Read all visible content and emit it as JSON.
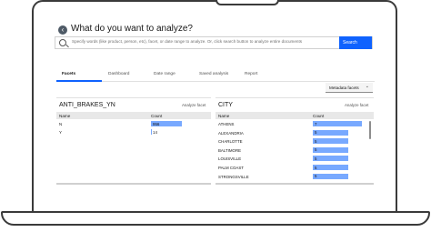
{
  "header": {
    "title": "What do you want to analyze?",
    "search_placeholder": "Specify words (like product, person, etc), facet, or date range to analyze. Or, click search button to analyze entire documents",
    "search_button": "Search"
  },
  "tabs": [
    "Facets",
    "Dashboard",
    "Date range",
    "Saved analysis",
    "Report"
  ],
  "metadata_dropdown": "Metadata facets",
  "left_panel": {
    "title": "ANTI_BRAKES_YN",
    "analyze_link": "Analyze facet",
    "columns": [
      "Name",
      "Count"
    ],
    "rows": [
      {
        "name": "N",
        "count": "956",
        "fraction": 1.0
      },
      {
        "name": "Y",
        "count": "14",
        "fraction": 0.02
      }
    ]
  },
  "right_panel": {
    "title": "CITY",
    "analyze_link": "Analyze facet",
    "columns": [
      "Name",
      "Count"
    ],
    "rows": [
      {
        "name": "ATHENS",
        "count": "7",
        "fraction": 1.0
      },
      {
        "name": "ALEXANDRIA",
        "count": "5",
        "fraction": 0.72
      },
      {
        "name": "CHARLOTTE",
        "count": "5",
        "fraction": 0.72
      },
      {
        "name": "BALTIMORE",
        "count": "5",
        "fraction": 0.72
      },
      {
        "name": "LOUISVILLE",
        "count": "5",
        "fraction": 0.72
      },
      {
        "name": "PALM COAST",
        "count": "5",
        "fraction": 0.72
      },
      {
        "name": "STRONGSVILLE",
        "count": "5",
        "fraction": 0.72
      }
    ]
  },
  "colors": {
    "accent": "#0f62fe",
    "bar": "#78a9ff"
  }
}
